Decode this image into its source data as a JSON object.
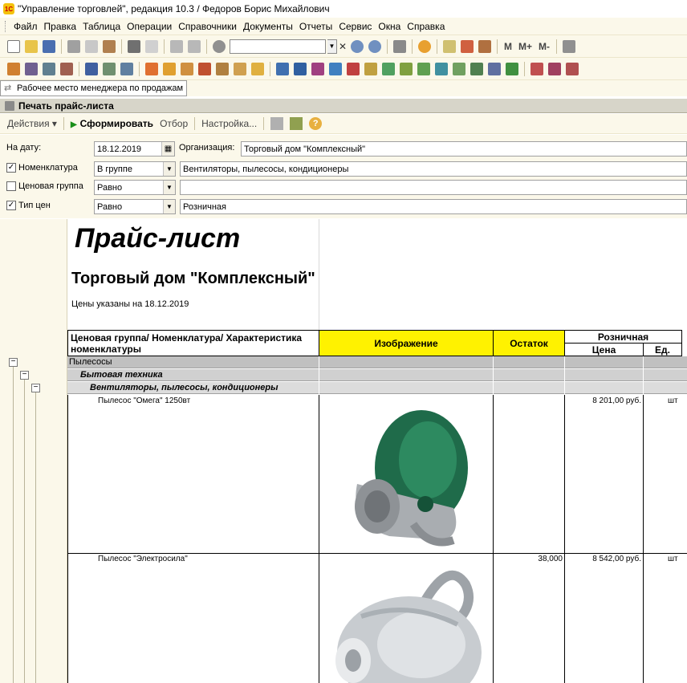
{
  "window": {
    "title": "\"Управление торговлей\", редакция 10.3 / Федоров Борис Михайлович",
    "logo": "1С"
  },
  "menu": [
    "Файл",
    "Правка",
    "Таблица",
    "Операции",
    "Справочники",
    "Документы",
    "Отчеты",
    "Сервис",
    "Окна",
    "Справка"
  ],
  "toolbar": {
    "memory_buttons": [
      "M",
      "M+",
      "M-"
    ]
  },
  "tab": {
    "label": "Рабочее место менеджера по продажам"
  },
  "document": {
    "title": "Печать прайс-листа"
  },
  "commands": {
    "actions": "Действия",
    "generate": "Сформировать",
    "filter": "Отбор",
    "settings": "Настройка..."
  },
  "filters": {
    "date_label": "На дату:",
    "date_value": "18.12.2019",
    "org_label": "Организация:",
    "org_value": "Торговый дом \"Комплексный\"",
    "rows": [
      {
        "label": "Номенклатура",
        "checked": "✓",
        "condition": "В группе",
        "value": "Вентиляторы, пылесосы, кондиционеры"
      },
      {
        "label": "Ценовая группа",
        "checked": "",
        "condition": "Равно",
        "value": ""
      },
      {
        "label": "Тип цен",
        "checked": "✓",
        "condition": "Равно",
        "value": "Розничная"
      }
    ]
  },
  "report": {
    "title": "Прайс-лист",
    "org": "Торговый дом \"Комплексный\"",
    "date_note": "Цены указаны на 18.12.2019",
    "headers": {
      "name": "Ценовая группа/ Номенклатура/ Характеристика номенклатуры",
      "image": "Изображение",
      "stock": "Остаток",
      "price_type": "Розничная",
      "price": "Цена",
      "unit": "Ед."
    },
    "groups": [
      {
        "label": "Пылесосы"
      },
      {
        "label": "Бытовая техника"
      },
      {
        "label": "Вентиляторы, пылесосы, кондиционеры"
      }
    ],
    "items": [
      {
        "name": "Пылесос \"Омега\" 1250вт",
        "stock": "",
        "price": "8 201,00 руб.",
        "unit": "шт",
        "color": "#1f6b4a"
      },
      {
        "name": "Пылесос \"Электросила\"",
        "stock": "38,000",
        "price": "8 542,00 руб.",
        "unit": "шт",
        "color": "#c8ccd0"
      }
    ],
    "toggle_symbol": "−"
  }
}
